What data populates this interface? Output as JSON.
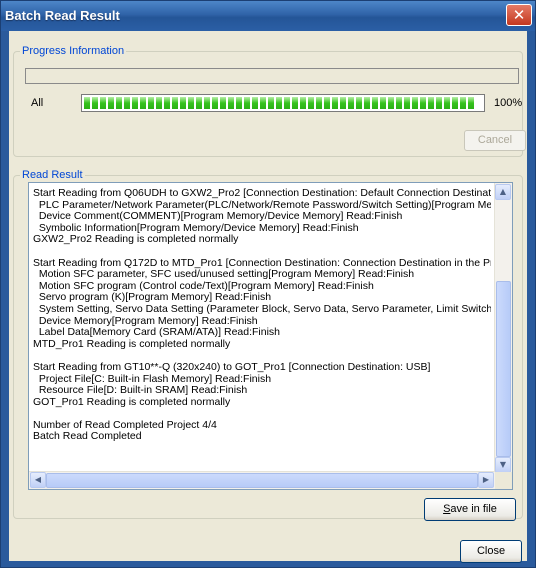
{
  "window": {
    "title": "Batch Read Result",
    "close_glyph": "✕"
  },
  "progress": {
    "legend": "Progress Information",
    "all_label": "All",
    "percent_text": "100%",
    "fraction": 1.0,
    "cancel_label": "Cancel"
  },
  "read_result": {
    "legend": "Read Result",
    "lines": [
      "Start Reading from Q06UDH to GXW2_Pro2 [Connection Destination: Default Connection Destination]",
      "  PLC Parameter/Network Parameter(PLC/Network/Remote Password/Switch Setting)[Program Memory/De",
      "  Device Comment(COMMENT)[Program Memory/Device Memory] Read:Finish",
      "  Symbolic Information[Program Memory/Device Memory] Read:Finish",
      "GXW2_Pro2 Reading is completed normally",
      "",
      "Start Reading from Q172D to MTD_Pro1 [Connection Destination: Connection Destination in the Project]",
      "  Motion SFC parameter, SFC used/unused setting[Program Memory] Read:Finish",
      "  Motion SFC program (Control code/Text)[Program Memory] Read:Finish",
      "  Servo program (K)[Program Memory] Read:Finish",
      "  System Setting, Servo Data Setting (Parameter Block, Servo Data, Servo Parameter, Limit Switch Output",
      "  Device Memory[Program Memory] Read:Finish",
      "  Label Data[Memory Card (SRAM/ATA)] Read:Finish",
      "MTD_Pro1 Reading is completed normally",
      "",
      "Start Reading from GT10**-Q (320x240) to GOT_Pro1 [Connection Destination: USB]",
      "  Project File[C: Built-in Flash Memory] Read:Finish",
      "  Resource File[D: Built-in SRAM] Read:Finish",
      "GOT_Pro1 Reading is completed normally",
      "",
      "Number of Read Completed Project 4/4",
      "Batch Read Completed"
    ],
    "save_label_underlined": "S",
    "save_label_rest": "ave in file"
  },
  "footer": {
    "close_label": "Close"
  },
  "colors": {
    "progress_green": "#36c21d",
    "legend_blue": "#0046d5",
    "title_bar": "#2f63a8"
  }
}
